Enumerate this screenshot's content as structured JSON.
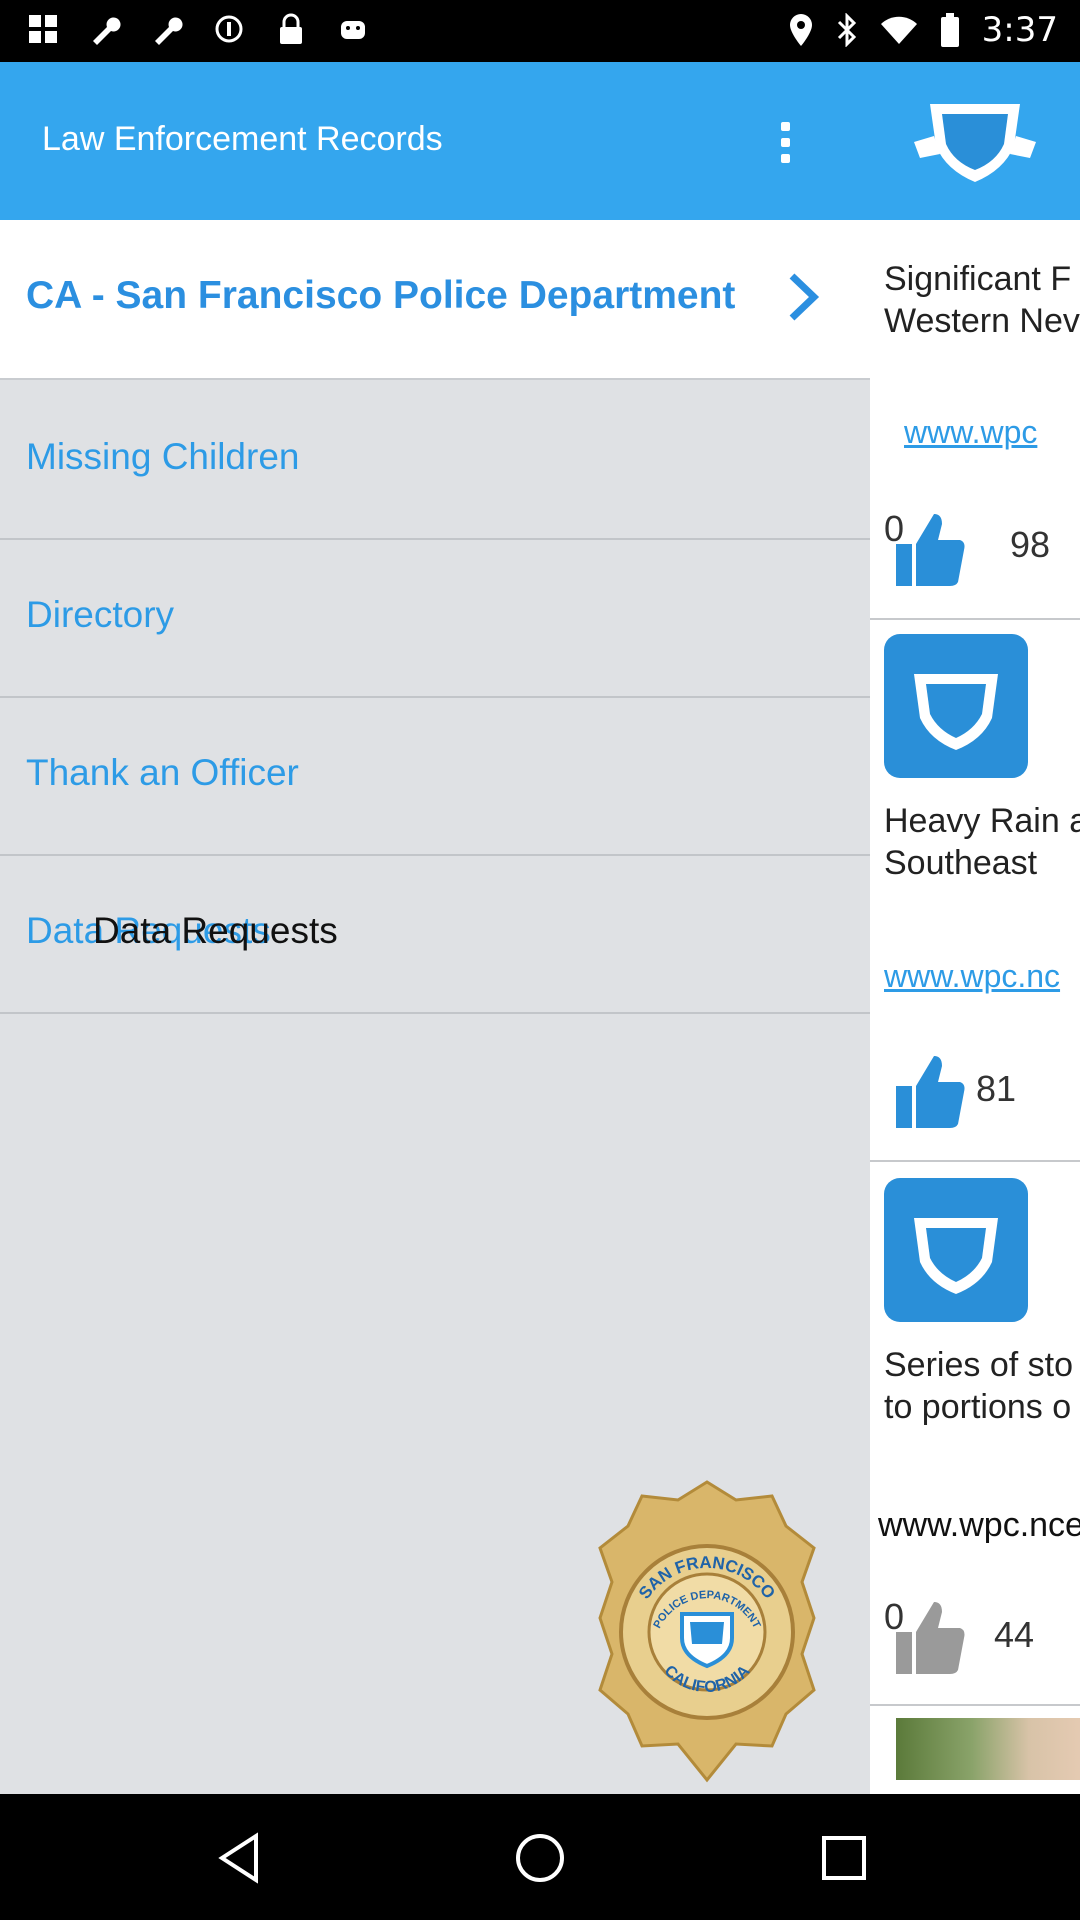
{
  "status_bar": {
    "time": "3:37",
    "left_icons": [
      "grid-app-icon",
      "wrench-icon",
      "wrench-icon",
      "alarm-icon",
      "lock-icon",
      "android-icon"
    ],
    "right_icons": [
      "location-icon",
      "bluetooth-icon",
      "wifi-icon",
      "battery-icon"
    ]
  },
  "drawer": {
    "title": "Law Enforcement Records",
    "department": "CA - San Francisco Police Department",
    "items": [
      {
        "label": "Missing Children"
      },
      {
        "label": "Directory"
      },
      {
        "label": "Thank an Officer"
      },
      {
        "label": "Data Requests"
      }
    ],
    "overlay_text": "Data Requests"
  },
  "badge": {
    "text_top": "SAN FRANCISCO",
    "text_mid": "POLICE DEPARTMENT",
    "text_bottom": "CALIFORNIA"
  },
  "feed": {
    "cards": [
      {
        "title_line1": "Significant F",
        "title_line2": "Western Nev",
        "link": "www.wpc",
        "count_left": "0",
        "count_right": "98"
      },
      {
        "title_line1": "Heavy Rain a",
        "title_line2": "Southeast",
        "link": "www.wpc.nc",
        "count_right": "81"
      },
      {
        "title_line1": "Series of sto",
        "title_line2": "to portions o",
        "link": "www.wpc.ncep",
        "count_left": "0",
        "count_right": "44"
      }
    ]
  },
  "colors": {
    "header_blue": "#34a6ee",
    "link_blue": "#2d9be6"
  }
}
